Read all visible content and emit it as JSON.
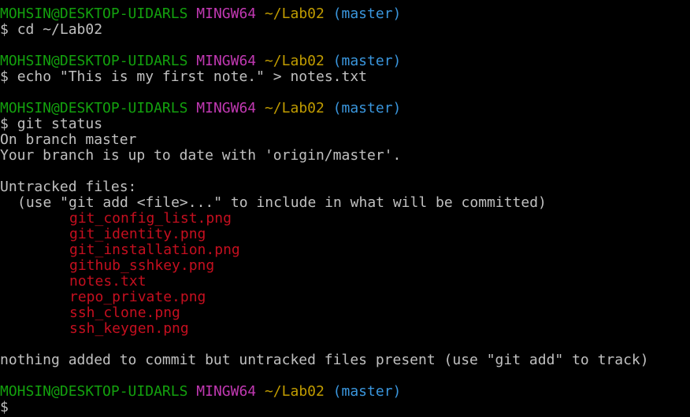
{
  "colors": {
    "background": "#000000",
    "text": "#c0c0c0",
    "user_host": "#13a10e",
    "system": "#c239b3",
    "path": "#c19c00",
    "branch": "#3a96dd",
    "untracked": "#c50f1f"
  },
  "prompt": {
    "user_host": "MOHSIN@DESKTOP-UIDARLS",
    "system": "MINGW64",
    "path": "~/Lab02",
    "branch": "(master)",
    "symbol": "$"
  },
  "commands": {
    "cmd1": "cd ~/Lab02",
    "cmd2": "echo \"This is my first note.\" > notes.txt",
    "cmd3": "git status"
  },
  "status_output": {
    "branch_line": "On branch master",
    "uptodate_line": "Your branch is up to date with 'origin/master'.",
    "untracked_header": "Untracked files:",
    "hint": "(use \"git add <file>...\" to include in what will be committed)",
    "files": [
      "git_config_list.png",
      "git_identity.png",
      "git_installation.png",
      "github_sshkey.png",
      "notes.txt",
      "repo_private.png",
      "ssh_clone.png",
      "ssh_keygen.png"
    ],
    "summary": "nothing added to commit but untracked files present (use \"git add\" to track)"
  }
}
